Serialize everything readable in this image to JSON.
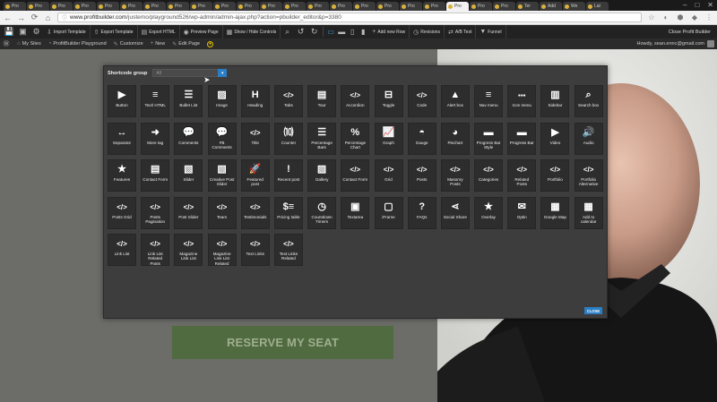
{
  "browser": {
    "tabs": [
      {
        "label": "Pro",
        "active": false
      },
      {
        "label": "Pro",
        "active": false
      },
      {
        "label": "Pro",
        "active": false
      },
      {
        "label": "Pro",
        "active": false
      },
      {
        "label": "Pro",
        "active": false
      },
      {
        "label": "Pro",
        "active": false
      },
      {
        "label": "Pro",
        "active": false
      },
      {
        "label": "Pro",
        "active": false
      },
      {
        "label": "Pro",
        "active": false
      },
      {
        "label": "Pro",
        "active": false
      },
      {
        "label": "Pro",
        "active": false
      },
      {
        "label": "Pro",
        "active": false
      },
      {
        "label": "Pro",
        "active": false
      },
      {
        "label": "Pro",
        "active": false
      },
      {
        "label": "Pro",
        "active": false
      },
      {
        "label": "Pro",
        "active": false
      },
      {
        "label": "Pro",
        "active": false
      },
      {
        "label": "Pro",
        "active": false
      },
      {
        "label": "Pro",
        "active": false
      },
      {
        "label": "Pro",
        "active": true
      },
      {
        "label": "Pro",
        "active": false
      },
      {
        "label": "Pro",
        "active": false
      },
      {
        "label": "Ter",
        "active": false
      },
      {
        "label": "Add",
        "active": false
      },
      {
        "label": "We",
        "active": false
      },
      {
        "label": "Lat",
        "active": false
      }
    ],
    "url_domain": "www.profitbuilder.com",
    "url_path": "/justemo/playground526/wp-admin/admin-ajax.php?action=pbuilder_editor&p=3380"
  },
  "toolbar": {
    "items": [
      "Import Template",
      "Export Template",
      "Export HTML",
      "Preview Page",
      "Show / Hide Controls",
      "Add new Row",
      "Revisions",
      "A/B Test",
      "Funnel"
    ],
    "close_label": "Close Profit Builder"
  },
  "adminbar": {
    "items": [
      "My Sites",
      "ProfitBuilder Playground",
      "Customize",
      "New",
      "Edit Page"
    ],
    "howdy": "Howdy, sean.ennc@gmail.com"
  },
  "page": {
    "cta_label": "RESERVE MY SEAT"
  },
  "modal": {
    "group_label": "Shortcode group",
    "group_value": "All",
    "close_label": "CLOSE",
    "accent_color": "#2a7ec4",
    "shortcodes": [
      {
        "label": "Button",
        "icon": "button-icon"
      },
      {
        "label": "Text/ HTML",
        "icon": "text-icon"
      },
      {
        "label": "Bullet List",
        "icon": "list-icon"
      },
      {
        "label": "Image",
        "icon": "image-icon"
      },
      {
        "label": "Heading",
        "icon": "heading-icon"
      },
      {
        "label": "Tabs",
        "icon": "code-icon"
      },
      {
        "label": "Tour",
        "icon": "tour-icon"
      },
      {
        "label": "Accordion",
        "icon": "code-icon"
      },
      {
        "label": "Toggle",
        "icon": "toggle-icon"
      },
      {
        "label": "Code",
        "icon": "code-icon"
      },
      {
        "label": "Alert box",
        "icon": "alert-icon"
      },
      {
        "label": "Nav menu",
        "icon": "menu-icon"
      },
      {
        "label": "Icon menu",
        "icon": "dots-icon"
      },
      {
        "label": "Sidebar",
        "icon": "sidebar-icon"
      },
      {
        "label": "Search box",
        "icon": "search-icon"
      },
      {
        "label": "Separator",
        "icon": "separator-icon"
      },
      {
        "label": "More tag",
        "icon": "arrow-circle-icon"
      },
      {
        "label": "Comments",
        "icon": "comment-icon"
      },
      {
        "label": "FB Comments",
        "icon": "comments-icon"
      },
      {
        "label": "Title",
        "icon": "code-icon"
      },
      {
        "label": "Counter",
        "icon": "counter-icon"
      },
      {
        "label": "Percentage Bars",
        "icon": "bars-icon"
      },
      {
        "label": "Percentage Chart",
        "icon": "percent-icon"
      },
      {
        "label": "Graph",
        "icon": "graph-icon"
      },
      {
        "label": "Gauge",
        "icon": "gauge-icon"
      },
      {
        "label": "Piechart",
        "icon": "piechart-icon"
      },
      {
        "label": "Progress Bar Style",
        "icon": "progress-icon"
      },
      {
        "label": "Progress Bar",
        "icon": "progress-icon"
      },
      {
        "label": "Video",
        "icon": "video-icon"
      },
      {
        "label": "Audio",
        "icon": "audio-icon"
      },
      {
        "label": "Features",
        "icon": "star-icon"
      },
      {
        "label": "Contact Form",
        "icon": "form-icon"
      },
      {
        "label": "Slider",
        "icon": "slider-icon"
      },
      {
        "label": "Creative Post Slider",
        "icon": "creative-slider-icon"
      },
      {
        "label": "Featured post",
        "icon": "rocket-icon"
      },
      {
        "label": "Recent post",
        "icon": "alert-square-icon"
      },
      {
        "label": "Gallery",
        "icon": "gallery-icon"
      },
      {
        "label": "Contact Form",
        "icon": "code-icon"
      },
      {
        "label": "Grid",
        "icon": "code-icon"
      },
      {
        "label": "Posts",
        "icon": "code-icon"
      },
      {
        "label": "Masonry Posts",
        "icon": "code-icon"
      },
      {
        "label": "Categories",
        "icon": "code-icon"
      },
      {
        "label": "Related Posts",
        "icon": "code-icon"
      },
      {
        "label": "Portfolio",
        "icon": "code-icon"
      },
      {
        "label": "Portfolio Alternative",
        "icon": "code-icon"
      },
      {
        "label": "Posts Grid",
        "icon": "code-icon"
      },
      {
        "label": "Posts Pagination",
        "icon": "code-icon"
      },
      {
        "label": "Post Slider",
        "icon": "code-icon"
      },
      {
        "label": "Team",
        "icon": "code-icon"
      },
      {
        "label": "Testimonials",
        "icon": "code-icon"
      },
      {
        "label": "Pricing table",
        "icon": "pricing-icon"
      },
      {
        "label": "Countdown Timers",
        "icon": "clock-icon"
      },
      {
        "label": "Textarea",
        "icon": "textarea-icon"
      },
      {
        "label": "iFrame",
        "icon": "iframe-icon"
      },
      {
        "label": "FAQs",
        "icon": "question-icon"
      },
      {
        "label": "Social Share",
        "icon": "share-icon"
      },
      {
        "label": "Overlay",
        "icon": "star-icon"
      },
      {
        "label": "Optin",
        "icon": "envelope-icon"
      },
      {
        "label": "Google Map",
        "icon": "map-icon"
      },
      {
        "label": "Add to calendar",
        "icon": "calendar-icon"
      },
      {
        "label": "Link List",
        "icon": "code-icon"
      },
      {
        "label": "Link List Related Posts",
        "icon": "code-icon"
      },
      {
        "label": "Magazine Link List",
        "icon": "code-icon"
      },
      {
        "label": "Magazine Link List Related",
        "icon": "code-icon"
      },
      {
        "label": "Text Links",
        "icon": "code-icon"
      },
      {
        "label": "Text Links Related",
        "icon": "code-icon"
      }
    ]
  }
}
